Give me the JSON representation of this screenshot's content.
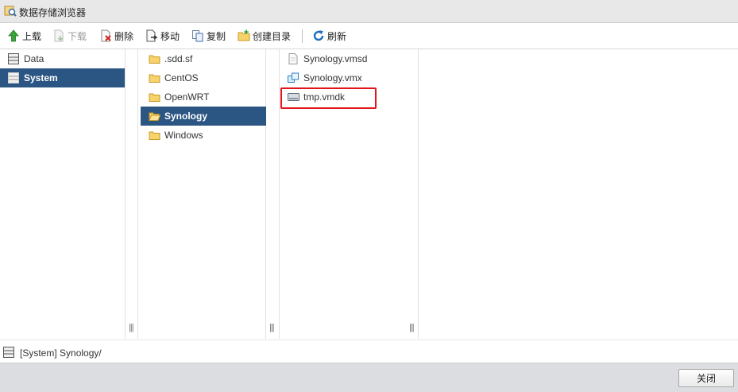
{
  "window": {
    "title": "数据存储浏览器",
    "icon": "datastore-browser-icon"
  },
  "toolbar": {
    "upload": "上载",
    "download": "下载",
    "delete": "删除",
    "move": "移动",
    "copy": "复制",
    "mkdir": "创建目录",
    "refresh": "刷新"
  },
  "datastores": [
    {
      "label": "Data",
      "icon": "datastore-icon",
      "selected": false
    },
    {
      "label": "System",
      "icon": "datastore-icon",
      "selected": true
    }
  ],
  "folders": [
    {
      "label": ".sdd.sf",
      "icon": "folder-icon",
      "selected": false
    },
    {
      "label": "CentOS",
      "icon": "folder-icon",
      "selected": false
    },
    {
      "label": "OpenWRT",
      "icon": "folder-icon",
      "selected": false
    },
    {
      "label": "Synology",
      "icon": "folder-open-icon",
      "selected": true
    },
    {
      "label": "Windows",
      "icon": "folder-icon",
      "selected": false
    }
  ],
  "files": [
    {
      "label": "Synology.vmsd",
      "icon": "file-icon"
    },
    {
      "label": "Synology.vmx",
      "icon": "vm-config-icon"
    },
    {
      "label": "tmp.vmdk",
      "icon": "virtual-disk-icon",
      "highlighted": true
    }
  ],
  "path": "[System] Synology/",
  "footer": {
    "close": "关闭"
  },
  "colors": {
    "selection": "#2b5583",
    "highlight": "#e0161c",
    "footer": "#dcdde0"
  }
}
